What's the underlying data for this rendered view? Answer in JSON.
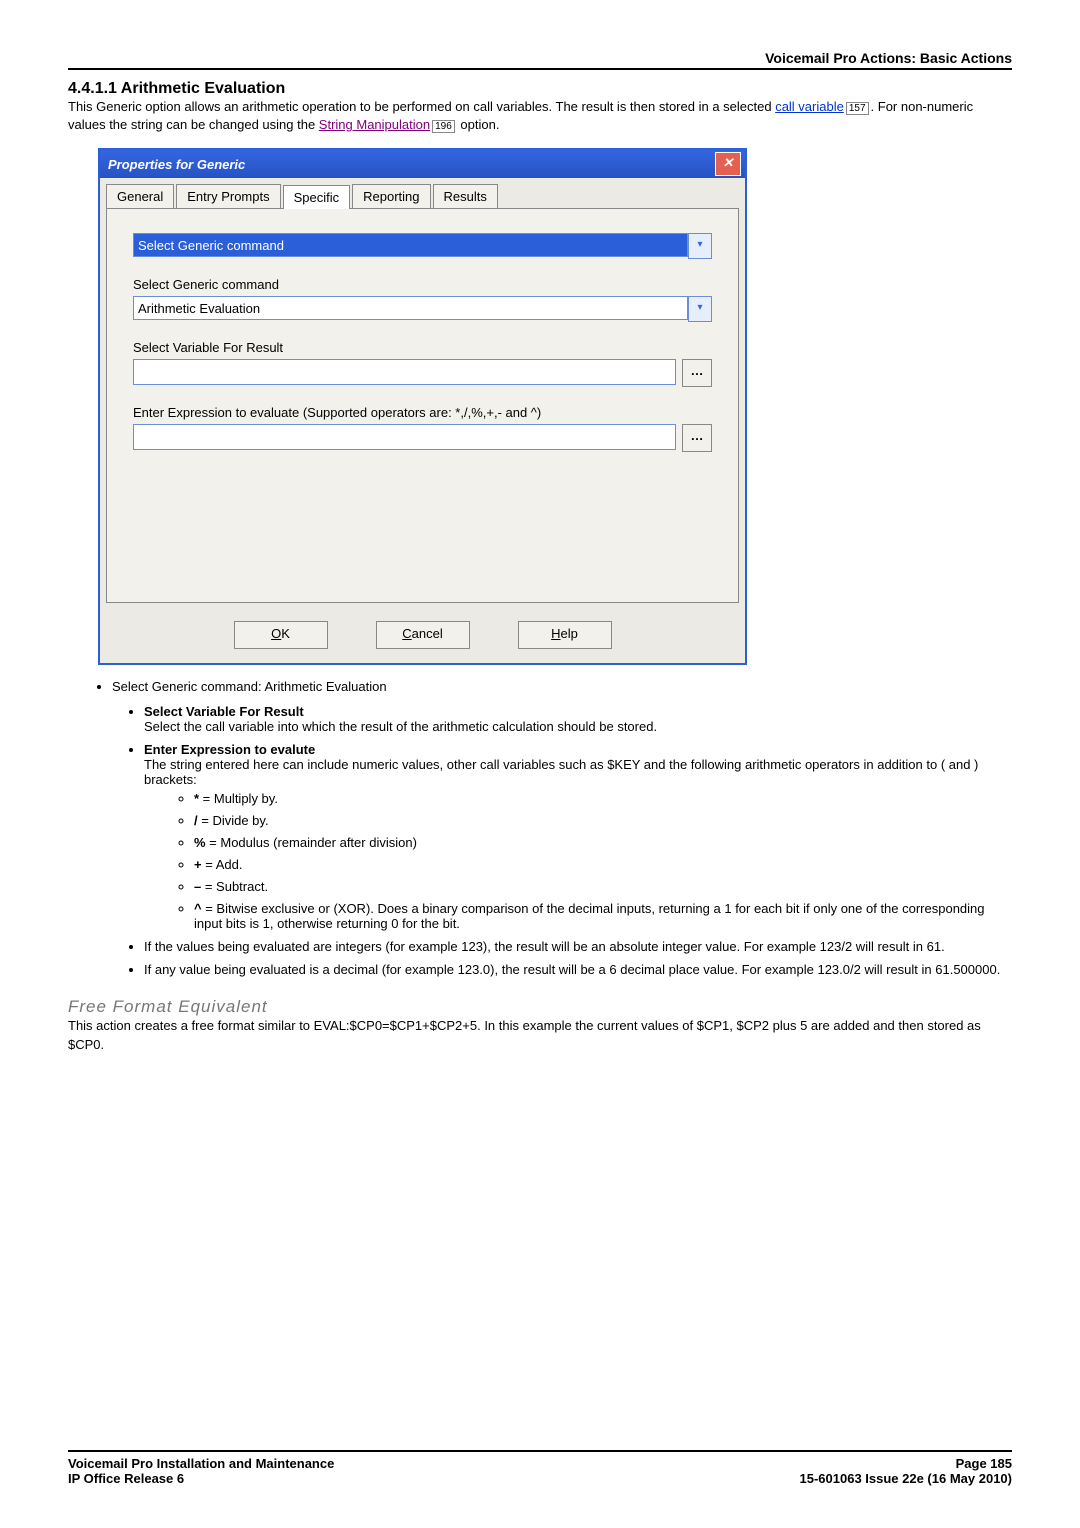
{
  "header": {
    "category": "Voicemail Pro Actions: Basic Actions",
    "section": "4.4.1.1 Arithmetic Evaluation"
  },
  "intro": {
    "p1a": "This Generic option allows an arithmetic operation to be performed on call variables. The result is then stored in a selected ",
    "link1": "call variable",
    "sup1": "157",
    "p1b": ". For non-numeric values the string can be changed using the ",
    "link2": "String Manipulation",
    "sup2": "196",
    "p1c": " option."
  },
  "dialog": {
    "title": "Properties for Generic",
    "tabs": {
      "general": "General",
      "entry": "Entry Prompts",
      "specific": "Specific",
      "reporting": "Reporting",
      "results": "Results"
    },
    "field1_value": "Select Generic command",
    "field2_label": "Select Generic command",
    "field2_value": "Arithmetic Evaluation",
    "field3_label": "Select Variable For Result",
    "field3_value": "",
    "field4_label": "Enter Expression to evaluate (Supported operators are: *,/,%,+,- and ^)",
    "field4_value": "",
    "ok": "OK",
    "cancel": "Cancel",
    "help": "Help"
  },
  "list": {
    "top": "Select Generic command: Arithmetic Evaluation",
    "svfr_label": "Select Variable For Result",
    "svfr_text": "Select the call variable into which the result of the arithmetic calculation should be stored.",
    "expr_label": "Enter Expression to evalute",
    "expr_text": "The string entered here can include numeric values, other call variables such as $KEY and the following arithmetic operators in addition to ( and ) brackets:",
    "ops": {
      "mul_k": "*",
      "mul_v": " = Multiply by.",
      "div_k": "/",
      "div_v": " = Divide by.",
      "mod_k": "%",
      "mod_v": " = Modulus (remainder after division)",
      "add_k": "+",
      "add_v": " = Add.",
      "sub_k": "–",
      "sub_v": " = Subtract.",
      "xor_k": "^",
      "xor_v": " = Bitwise exclusive or (XOR). Does a binary comparison of the decimal inputs, returning a 1 for each bit if only one of the corresponding input bits is 1, otherwise returning 0 for the bit."
    },
    "int_note": "If the values being evaluated are integers (for example 123), the result will be an absolute integer value. For example 123/2 will result in 61.",
    "dec_note": "If any value being evaluated is a decimal (for example 123.0), the result will be a 6 decimal place value. For example 123.0/2 will result in 61.500000."
  },
  "free": {
    "heading": "Free Format Equivalent",
    "text": "This action creates a free format similar to EVAL:$CP0=$CP1+$CP2+5. In this example the current values of $CP1, $CP2 plus 5 are added and then stored as $CP0."
  },
  "footer": {
    "left1": "Voicemail Pro Installation and Maintenance",
    "left2": "IP Office Release 6",
    "right1": "Page 185",
    "right2": "15-601063 Issue 22e (16 May 2010)"
  }
}
